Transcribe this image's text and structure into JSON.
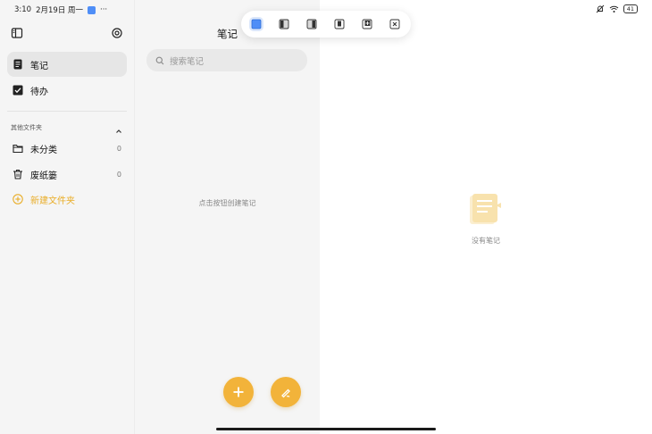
{
  "status_bar": {
    "time": "3:10",
    "date": "2月19日 周一",
    "more": "···",
    "battery": "41"
  },
  "sidebar": {
    "items": [
      {
        "label": "笔记"
      },
      {
        "label": "待办"
      }
    ],
    "section_label": "其他文件夹",
    "folders": [
      {
        "label": "未分类",
        "count": "0"
      },
      {
        "label": "废纸篓",
        "count": "0"
      }
    ],
    "new_folder_label": "新建文件夹"
  },
  "list": {
    "title": "笔记",
    "search_placeholder": "搜索笔记",
    "empty_hint": "点击按钮创建笔记"
  },
  "detail": {
    "empty_text": "没有笔记"
  },
  "colors": {
    "accent": "#f2b33a",
    "active_window_mode": "#4f8ef7"
  },
  "icons": {
    "sidebar_toggle": "sidebar-icon",
    "settings": "gear-icon",
    "fab_add": "plus-icon",
    "fab_draw": "pen-icon"
  }
}
